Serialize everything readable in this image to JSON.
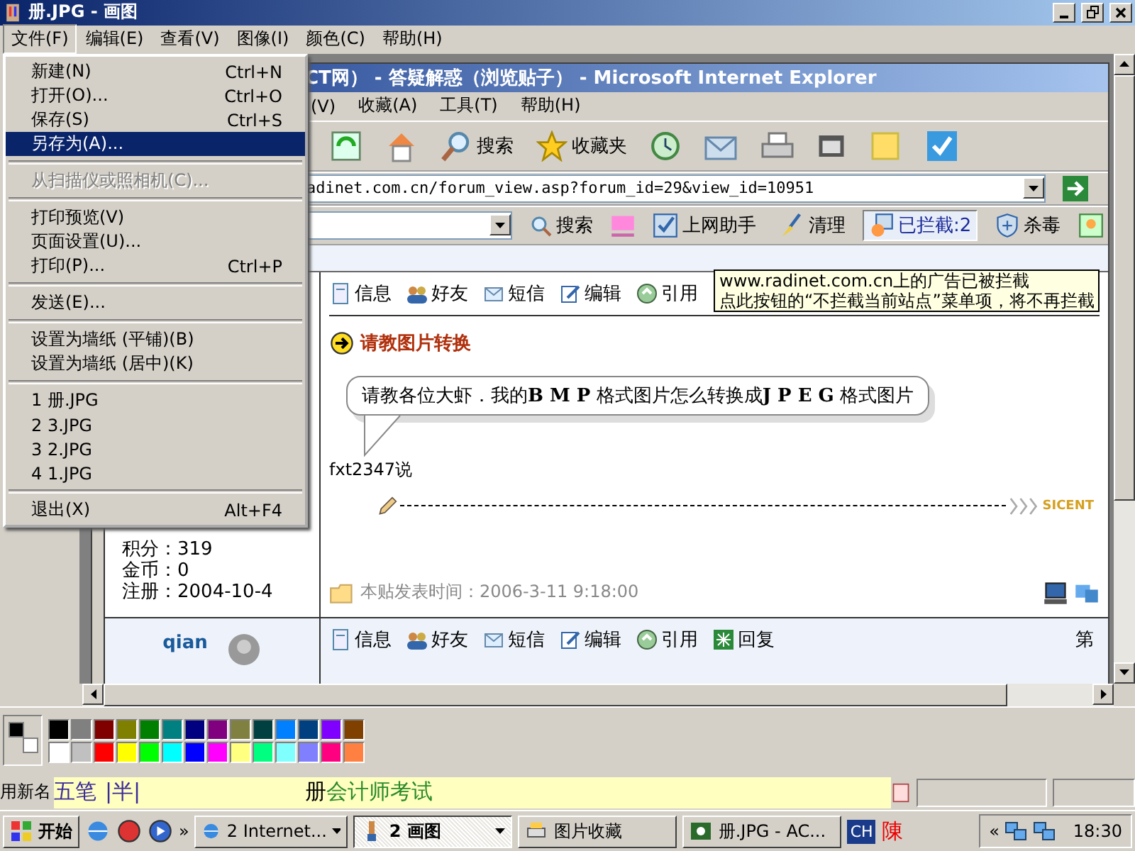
{
  "paint": {
    "title": "册.JPG - 画图",
    "menu": [
      {
        "label": "文件(F)",
        "selected": true
      },
      {
        "label": "编辑(E)",
        "selected": false
      },
      {
        "label": "查看(V)",
        "selected": false
      },
      {
        "label": "图像(I)",
        "selected": false
      },
      {
        "label": "颜色(C)",
        "selected": false
      },
      {
        "label": "帮助(H)",
        "selected": false
      }
    ],
    "file_menu": [
      [
        {
          "label": "新建(N)",
          "shortcut": "Ctrl+N",
          "selected": false,
          "disabled": false
        },
        {
          "label": "打开(O)...",
          "shortcut": "Ctrl+O",
          "selected": false,
          "disabled": false
        },
        {
          "label": "保存(S)",
          "shortcut": "Ctrl+S",
          "selected": false,
          "disabled": false
        },
        {
          "label": "另存为(A)...",
          "selected": true,
          "disabled": false
        }
      ],
      [
        {
          "label": "从扫描仪或照相机(C)...",
          "selected": false,
          "disabled": true
        }
      ],
      [
        {
          "label": "打印预览(V)",
          "selected": false,
          "disabled": false
        },
        {
          "label": "页面设置(U)...",
          "selected": false,
          "disabled": false
        },
        {
          "label": "打印(P)...",
          "shortcut": "Ctrl+P",
          "selected": false,
          "disabled": false
        }
      ],
      [
        {
          "label": "发送(E)...",
          "selected": false,
          "disabled": false
        }
      ],
      [
        {
          "label": "设置为墙纸 (平铺)(B)",
          "selected": false,
          "disabled": false
        },
        {
          "label": "设置为墙纸 (居中)(K)",
          "selected": false,
          "disabled": false
        }
      ],
      [
        {
          "label": "1 册.JPG",
          "selected": false,
          "disabled": false
        },
        {
          "label": "2 3.JPG",
          "selected": false,
          "disabled": false
        },
        {
          "label": "3 2.JPG",
          "selected": false,
          "disabled": false
        },
        {
          "label": "4 1.JPG",
          "selected": false,
          "disabled": false
        }
      ],
      [
        {
          "label": "退出(X)",
          "shortcut": "Alt+F4",
          "selected": false,
          "disabled": false
        }
      ]
    ]
  },
  "ie": {
    "title": "CT网） - 答疑解惑（浏览贴子） - Microsoft Internet Explorer",
    "menu": [
      "(V)",
      "收藏(A)",
      "工具(T)",
      "帮助(H)"
    ],
    "toolbar": {
      "search": "搜索",
      "favorites": "收藏夹"
    },
    "address": "adinet.com.cn/forum_view.asp?forum_id=29&view_id=10951",
    "toolbar2": {
      "search": "搜索",
      "helper": "上网助手",
      "clean": "清理",
      "blocked": "已拦截:2",
      "antivirus": "杀毒"
    },
    "tooltip": [
      "www.radinet.com.cn上的广告已被拦截",
      "点此按钮的“不拦截当前站点”菜单项，将不再拦截"
    ],
    "posts": [
      {
        "stats": [
          "积分：319",
          "金币：0",
          "注册：2004-10-4"
        ],
        "actions": [
          "信息",
          "好友",
          "短信",
          "编辑",
          "引用"
        ],
        "title": "请教图片转换",
        "bubble": "请教各位大虾．我的**B M P** 格式图片怎么转换成**J P E G** 格式图片",
        "author": "fxt2347说",
        "signature": "SICENT",
        "time": "本贴发表时间：2006-3-11 9:18:00"
      },
      {
        "username": "qian",
        "actions": [
          "信息",
          "好友",
          "短信",
          "编辑",
          "引用",
          "回复"
        ],
        "floor": "第"
      }
    ]
  },
  "palette": {
    "current": [
      {
        "color": "#000000"
      },
      {
        "color": "#ffffff"
      }
    ],
    "swatches": [
      {
        "color": "#000000"
      },
      {
        "color": "#808080"
      },
      {
        "color": "#800000"
      },
      {
        "color": "#808000"
      },
      {
        "color": "#008000"
      },
      {
        "color": "#008080"
      },
      {
        "color": "#000080"
      },
      {
        "color": "#800080"
      },
      {
        "color": "#808040"
      },
      {
        "color": "#004040"
      },
      {
        "color": "#0080ff"
      },
      {
        "color": "#004080"
      },
      {
        "color": "#8000ff"
      },
      {
        "color": "#804000"
      },
      {
        "color": "#ffffff"
      },
      {
        "color": "#c0c0c0"
      },
      {
        "color": "#ff0000"
      },
      {
        "color": "#ffff00"
      },
      {
        "color": "#00ff00"
      },
      {
        "color": "#00ffff"
      },
      {
        "color": "#0000ff"
      },
      {
        "color": "#ff00ff"
      },
      {
        "color": "#ffff80"
      },
      {
        "color": "#00ff80"
      },
      {
        "color": "#80ffff"
      },
      {
        "color": "#8080ff"
      },
      {
        "color": "#ff0080"
      },
      {
        "color": "#ff8040"
      }
    ]
  },
  "status": "用新名",
  "ime": {
    "mode": "五笔",
    "width": "|半|",
    "composition": "册",
    "candidates": "会计师考试"
  },
  "taskbar": {
    "start": "开始",
    "more": "»",
    "tasks": [
      {
        "label": "2 Internet...",
        "selected": false,
        "grouped": true
      },
      {
        "label": "2 画图",
        "selected": true,
        "grouped": true
      },
      {
        "label": "图片收藏",
        "selected": false,
        "grouped": false
      },
      {
        "label": "册.JPG - AC...",
        "selected": false,
        "grouped": false
      }
    ],
    "tray": {
      "language": "CH",
      "ime": "陳",
      "expand": "«",
      "clock": "18:30"
    }
  }
}
